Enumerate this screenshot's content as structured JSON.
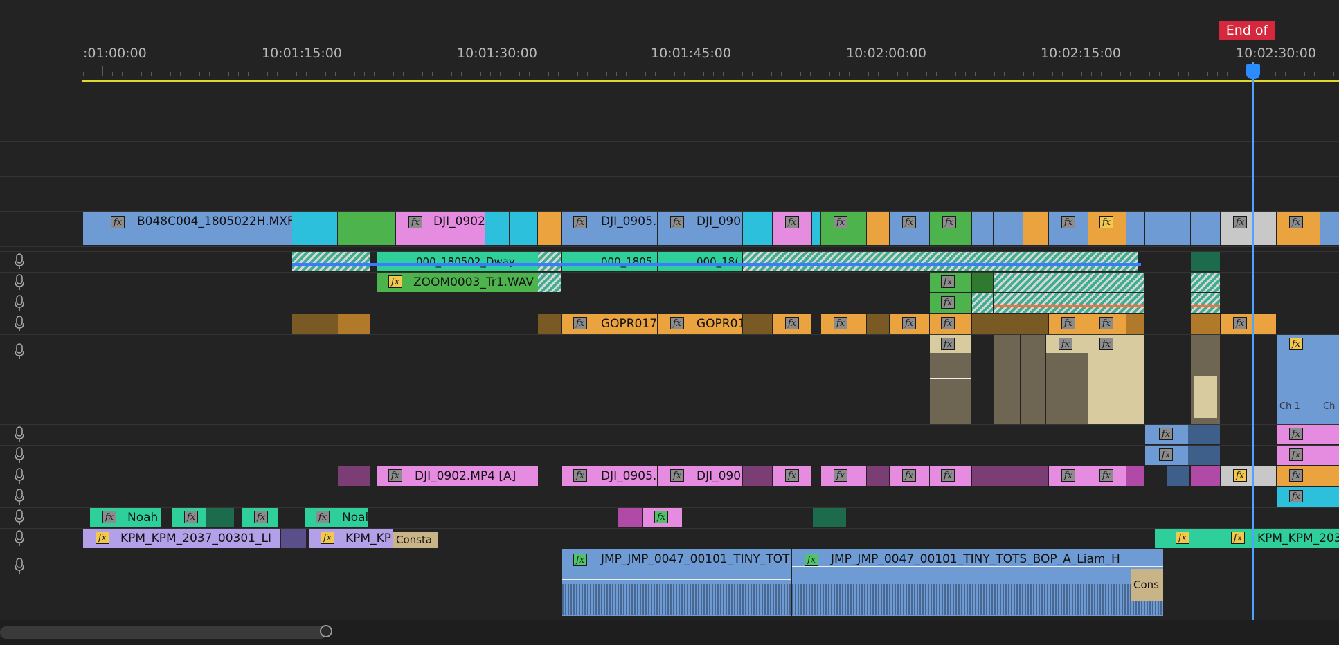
{
  "timeline": {
    "timecodes": [
      ":01:00:00",
      "10:01:15:00",
      "10:01:30:00",
      "10:01:45:00",
      "10:02:00:00",
      "10:02:15:00",
      "10:02:30:00"
    ],
    "end_marker": "End of",
    "playhead_timecode": "10:02:30:00"
  },
  "fx_label": "fx",
  "video": {
    "clips": [
      "B048C004_1805022H.MXF",
      "DJI_0902",
      "DJI_0905.I",
      "DJI_090"
    ]
  },
  "audio": {
    "a1": [
      "000_180502_Dway",
      "000_1805",
      "000_18("
    ],
    "a2": [
      "ZOOM0003_Tr1.WAV"
    ],
    "a4": [
      "GOPR017",
      "GOPR01"
    ],
    "a5": [
      "Ch 1",
      "Ch"
    ],
    "a8": [
      "DJI_0902.MP4 [A]",
      "DJI_0905.",
      "DJI_090"
    ],
    "a10": [
      "Noah",
      "Noal"
    ],
    "a11": [
      "KPM_KPM_2037_00301_LI",
      "KPM_KP",
      "Consta",
      "KPM_KPM_203"
    ],
    "a12": [
      "JMP_JMP_0047_00101_TINY_TOT",
      "JMP_JMP_0047_00101_TINY_TOTS_BOP_A_Liam_H",
      "Cons"
    ]
  },
  "colors": {
    "blue": "#6e9bd4",
    "cyan": "#2cc0dc",
    "green": "#4db34d",
    "pink": "#e58be0",
    "orange": "#eaa33e",
    "teal": "#2ecf9a",
    "lavender": "#b3a0e8",
    "tan": "#d9cba0",
    "playhead": "#4fa4ff",
    "end": "#d6283c"
  }
}
